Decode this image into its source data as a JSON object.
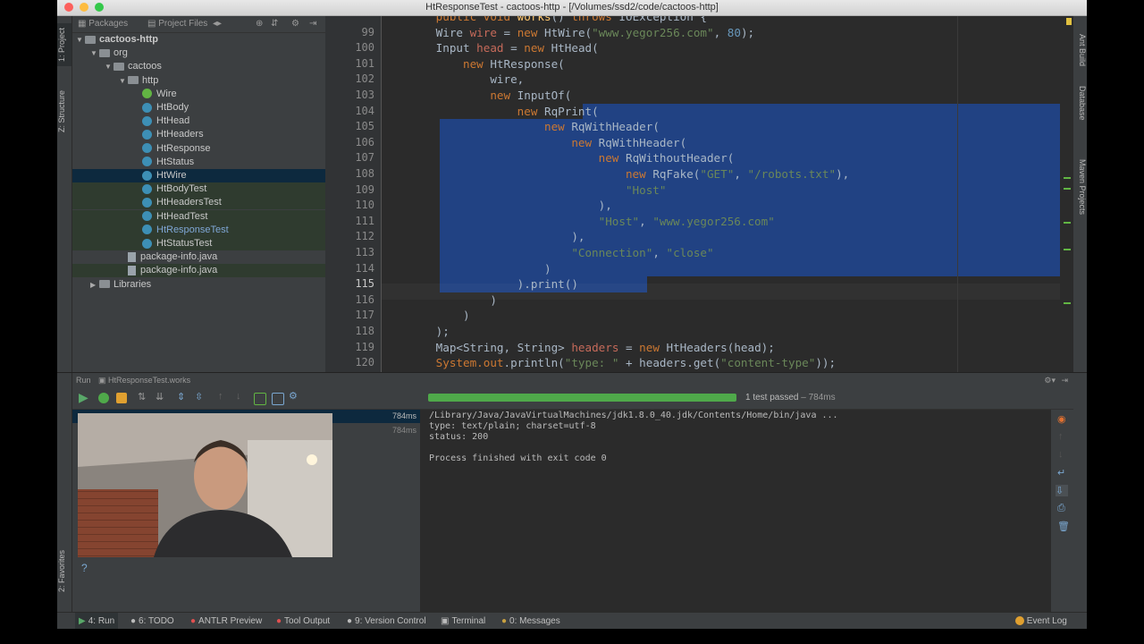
{
  "window": {
    "title": "HtResponseTest - cactoos-http - [/Volumes/ssd2/code/cactoos-http]"
  },
  "left_tool_tabs": [
    "1: Project",
    "Z: Structure",
    "2: Favorites"
  ],
  "right_tool_tabs": [
    "Ant Build",
    "Database",
    "Maven Projects"
  ],
  "project_panel": {
    "tabs": [
      "Packages",
      "Project Files"
    ],
    "tree": [
      {
        "label": "cactoos-http",
        "indent": 0,
        "icon": "folder-icon",
        "expanded": true
      },
      {
        "label": "org",
        "indent": 1,
        "icon": "package-icon",
        "expanded": true
      },
      {
        "label": "cactoos",
        "indent": 2,
        "icon": "package-icon",
        "expanded": true
      },
      {
        "label": "http",
        "indent": 3,
        "icon": "package-icon",
        "expanded": true
      },
      {
        "label": "Wire",
        "indent": 4,
        "icon": "interface-icon"
      },
      {
        "label": "HtBody",
        "indent": 4,
        "icon": "class-icon"
      },
      {
        "label": "HtHead",
        "indent": 4,
        "icon": "class-icon"
      },
      {
        "label": "HtHeaders",
        "indent": 4,
        "icon": "class-icon"
      },
      {
        "label": "HtResponse",
        "indent": 4,
        "icon": "class-icon"
      },
      {
        "label": "HtStatus",
        "indent": 4,
        "icon": "class-icon"
      },
      {
        "label": "HtWire",
        "indent": 4,
        "icon": "class-icon",
        "selected": true
      },
      {
        "label": "HtBodyTest",
        "indent": 4,
        "icon": "class-icon",
        "test": true
      },
      {
        "label": "HtHeadersTest",
        "indent": 4,
        "icon": "class-icon",
        "test": true
      },
      {
        "label": "HtHeadTest",
        "indent": 4,
        "icon": "class-icon",
        "test": true
      },
      {
        "label": "HtResponseTest",
        "indent": 4,
        "icon": "class-icon",
        "test": true,
        "accent": true
      },
      {
        "label": "HtStatusTest",
        "indent": 4,
        "icon": "class-icon",
        "test": true
      },
      {
        "label": "package-info.java",
        "indent": 3,
        "icon": "file-icon"
      },
      {
        "label": "package-info.java",
        "indent": 3,
        "icon": "file-icon",
        "test": true
      },
      {
        "label": "Libraries",
        "indent": 1,
        "icon": "libraries-icon",
        "collapsed": true
      }
    ]
  },
  "editor": {
    "line_numbers": [
      "99",
      "100",
      "101",
      "102",
      "103",
      "104",
      "105",
      "106",
      "107",
      "108",
      "109",
      "110",
      "111",
      "112",
      "113",
      "114",
      "115",
      "116",
      "117",
      "118",
      "119",
      "120"
    ],
    "top_partial": "public void works() throws IOException {",
    "lines": [
      {
        "segs": [
          [
            "        ",
            ""
          ],
          [
            "Wire ",
            ""
          ],
          [
            "wire",
            "var"
          ],
          [
            " = ",
            ""
          ],
          [
            "new ",
            "kw"
          ],
          [
            "HtWire(",
            ""
          ],
          [
            "\"www.yegor256.com\"",
            "str"
          ],
          [
            ", ",
            ""
          ],
          [
            "80",
            "num"
          ],
          [
            ");",
            ""
          ]
        ]
      },
      {
        "segs": [
          [
            "        ",
            ""
          ],
          [
            "Input ",
            ""
          ],
          [
            "head",
            "var"
          ],
          [
            " = ",
            ""
          ],
          [
            "new ",
            "kw"
          ],
          [
            "HtHead(",
            ""
          ]
        ]
      },
      {
        "segs": [
          [
            "            ",
            ""
          ],
          [
            "new ",
            "kw"
          ],
          [
            "HtResponse(",
            ""
          ]
        ]
      },
      {
        "segs": [
          [
            "                ",
            ""
          ],
          [
            "wire,",
            ""
          ]
        ]
      },
      {
        "segs": [
          [
            "                ",
            ""
          ],
          [
            "new ",
            "kw"
          ],
          [
            "InputOf(",
            ""
          ]
        ]
      },
      {
        "segs": [
          [
            "                    ",
            ""
          ],
          [
            "new ",
            "kw"
          ],
          [
            "RqPrint(",
            ""
          ]
        ],
        "hl": "partial"
      },
      {
        "segs": [
          [
            "                        ",
            ""
          ],
          [
            "new ",
            "kw"
          ],
          [
            "RqWithHeader(",
            ""
          ]
        ],
        "hl": "full"
      },
      {
        "segs": [
          [
            "                            ",
            ""
          ],
          [
            "new ",
            "kw"
          ],
          [
            "RqWithHeader(",
            ""
          ]
        ],
        "hl": "full"
      },
      {
        "segs": [
          [
            "                                ",
            ""
          ],
          [
            "new ",
            "kw"
          ],
          [
            "RqWithoutHeader(",
            ""
          ]
        ],
        "hl": "full"
      },
      {
        "segs": [
          [
            "                                    ",
            ""
          ],
          [
            "new ",
            "kw"
          ],
          [
            "RqFake(",
            ""
          ],
          [
            "\"GET\"",
            "str"
          ],
          [
            ", ",
            ""
          ],
          [
            "\"/robots.txt\"",
            "str"
          ],
          [
            "),",
            ""
          ]
        ],
        "hl": "full"
      },
      {
        "segs": [
          [
            "                                    ",
            ""
          ],
          [
            "\"Host\"",
            "str"
          ]
        ],
        "hl": "full"
      },
      {
        "segs": [
          [
            "                                ",
            ""
          ],
          [
            "),",
            ""
          ]
        ],
        "hl": "full"
      },
      {
        "segs": [
          [
            "                                ",
            ""
          ],
          [
            "\"Host\"",
            "str"
          ],
          [
            ", ",
            ""
          ],
          [
            "\"www.yegor256.com\"",
            "str"
          ]
        ],
        "hl": "full"
      },
      {
        "segs": [
          [
            "                            ",
            ""
          ],
          [
            "),",
            ""
          ]
        ],
        "hl": "full"
      },
      {
        "segs": [
          [
            "                            ",
            ""
          ],
          [
            "\"Connection\"",
            "str"
          ],
          [
            ", ",
            ""
          ],
          [
            "\"close\"",
            "str"
          ]
        ],
        "hl": "full"
      },
      {
        "segs": [
          [
            "                        ",
            ""
          ],
          [
            ")",
            ""
          ]
        ],
        "hl": "full"
      },
      {
        "segs": [
          [
            "                    ",
            ""
          ],
          [
            ").print()",
            ""
          ]
        ],
        "hl": "end"
      },
      {
        "segs": [
          [
            "                ",
            ""
          ],
          [
            ")",
            ""
          ]
        ]
      },
      {
        "segs": [
          [
            "            ",
            ""
          ],
          [
            ")",
            ""
          ]
        ]
      },
      {
        "segs": [
          [
            "        ",
            ""
          ],
          [
            ");",
            ""
          ]
        ]
      },
      {
        "segs": [
          [
            "        ",
            ""
          ],
          [
            "Map<String, String> ",
            ""
          ],
          [
            "headers",
            "var"
          ],
          [
            " = ",
            ""
          ],
          [
            "new ",
            "kw"
          ],
          [
            "HtHeaders(head);",
            ""
          ]
        ]
      },
      {
        "segs": [
          [
            "        ",
            ""
          ],
          [
            "System.",
            "kw"
          ],
          [
            "out",
            "kw"
          ],
          [
            ".println(",
            ""
          ],
          [
            "\"type: \"",
            "str"
          ],
          [
            " + ",
            ""
          ],
          [
            "headers",
            ""
          ],
          [
            ".get(",
            ""
          ],
          [
            "\"content-type\"",
            "str"
          ],
          [
            "));",
            ""
          ]
        ]
      }
    ]
  },
  "run": {
    "header_label": "Run",
    "config": "HtResponseTest.works",
    "progress_fraction": 1.0,
    "result_text": "1 test passed",
    "result_time": "– 784ms",
    "tree_times": [
      "784ms",
      "784ms"
    ],
    "console": [
      "/Library/Java/JavaVirtualMachines/jdk1.8.0_40.jdk/Contents/Home/bin/java ...",
      "type: text/plain; charset=utf-8",
      "status: 200",
      "",
      "Process finished with exit code 0"
    ]
  },
  "statusbar": {
    "items": [
      {
        "label": "4: Run",
        "icon": "run-icon",
        "active": true
      },
      {
        "label": "6: TODO",
        "icon": "todo-icon"
      },
      {
        "label": "ANTLR Preview",
        "icon": "antlr-icon"
      },
      {
        "label": "Tool Output",
        "icon": "tool-output-icon"
      },
      {
        "label": "9: Version Control",
        "icon": "vcs-icon"
      },
      {
        "label": "Terminal",
        "icon": "terminal-icon"
      },
      {
        "label": "0: Messages",
        "icon": "messages-icon"
      }
    ],
    "event_log": "Event Log"
  }
}
